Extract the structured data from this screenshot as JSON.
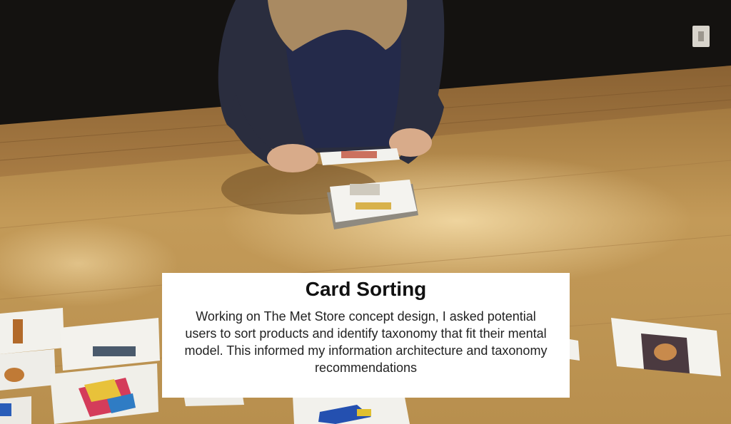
{
  "caption": {
    "title": "Card Sorting",
    "body": "Working on The Met Store concept design, I asked potential users to sort products and identify taxonomy that fit their mental model. This informed my information architecture and taxonomy recommendations"
  },
  "colors": {
    "wall": "#141210",
    "table": "#b8904f",
    "floor": "#9a6f3c",
    "sweater": "#2a2e42",
    "caption_background": "#ffffff"
  }
}
